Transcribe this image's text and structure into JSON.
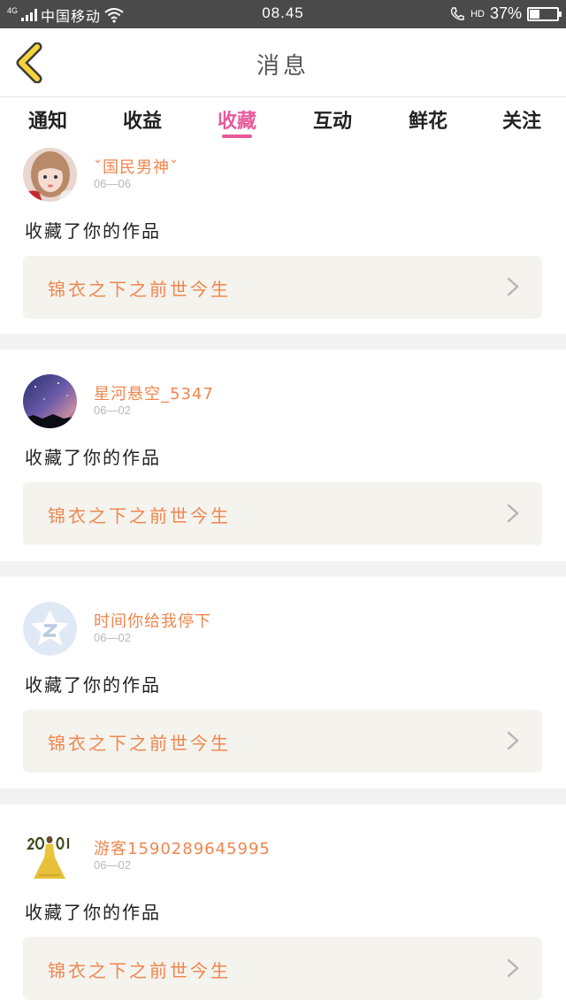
{
  "status_bar": {
    "network": "4G",
    "carrier": "中国移动",
    "time": "08.45",
    "hd": "HD",
    "battery": "37%",
    "battery_level": 0.37
  },
  "header": {
    "title": "消息"
  },
  "tabs": [
    {
      "label": "通知",
      "active": false
    },
    {
      "label": "收益",
      "active": false
    },
    {
      "label": "收藏",
      "active": true
    },
    {
      "label": "互动",
      "active": false
    },
    {
      "label": "鲜花",
      "active": false
    },
    {
      "label": "关注",
      "active": false
    }
  ],
  "messages": [
    {
      "username": "ˇ国民男神ˇ",
      "date": "06—06",
      "action": "收藏了你的作品",
      "work_title": "锦衣之下之前世今生",
      "avatar": "girl-photo"
    },
    {
      "username": "星河悬空_5347",
      "date": "06—02",
      "action": "收藏了你的作品",
      "work_title": "锦衣之下之前世今生",
      "avatar": "galaxy-photo"
    },
    {
      "username": "时间你给我停下",
      "date": "06—02",
      "action": "收藏了你的作品",
      "work_title": "锦衣之下之前世今生",
      "avatar": "default-star-avatar"
    },
    {
      "username": "游客1590289645995",
      "date": "06—02",
      "action": "收藏了你的作品",
      "work_title": "锦衣之下之前世今生",
      "avatar": "2018-figure-photo"
    }
  ],
  "colors": {
    "accent_pink": "#e85a9b",
    "username_orange": "#f0864e",
    "card_bg": "#f4f3ee",
    "back_icon_yellow": "#f5d33b"
  }
}
